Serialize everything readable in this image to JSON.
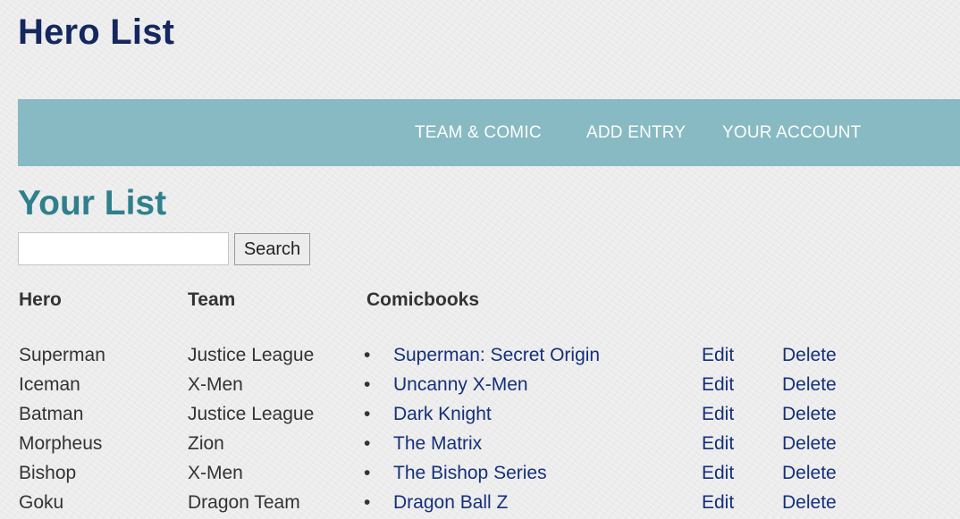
{
  "header": {
    "title": "Hero List"
  },
  "nav": {
    "items": [
      {
        "label": "TEAM & COMIC"
      },
      {
        "label": "ADD ENTRY"
      },
      {
        "label": "YOUR ACCOUNT"
      }
    ],
    "background": "#88bac3"
  },
  "main": {
    "title": "Your List",
    "search": {
      "value": "",
      "placeholder": "",
      "button_label": "Search"
    },
    "table": {
      "columns": [
        "Hero",
        "Team",
        "Comicbooks"
      ],
      "bullet": "•",
      "edit_label": "Edit",
      "delete_label": "Delete",
      "rows": [
        {
          "hero": "Superman",
          "team": "Justice League",
          "comic": "Superman: Secret Origin"
        },
        {
          "hero": "Iceman",
          "team": "X-Men",
          "comic": "Uncanny X-Men"
        },
        {
          "hero": "Batman",
          "team": "Justice League",
          "comic": "Dark Knight"
        },
        {
          "hero": "Morpheus",
          "team": "Zion",
          "comic": "The Matrix"
        },
        {
          "hero": "Bishop",
          "team": "X-Men",
          "comic": "The Bishop Series"
        },
        {
          "hero": "Goku",
          "team": "Dragon Team",
          "comic": "Dragon Ball Z"
        }
      ]
    }
  },
  "colors": {
    "title": "#14275e",
    "section_title": "#2f7f8c",
    "link": "#14307a"
  }
}
